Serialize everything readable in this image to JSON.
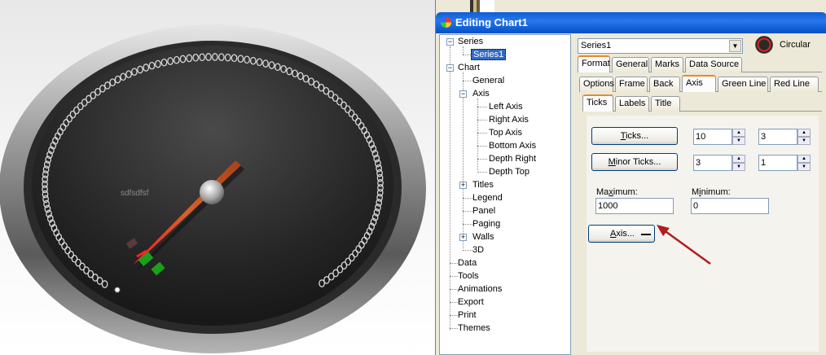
{
  "gauge": {
    "label": "sdfsdfsf",
    "colors": {
      "bezel": "#9a9a9a",
      "face": "#1e1e1e",
      "needle": "#c8501e",
      "accent": "#d81010",
      "green": "#1aa01a"
    }
  },
  "window": {
    "title": "Editing Chart1"
  },
  "tree": {
    "series": "Series",
    "series1": "Series1",
    "chart": "Chart",
    "general": "General",
    "axis": "Axis",
    "left_axis": "Left Axis",
    "right_axis": "Right Axis",
    "top_axis": "Top Axis",
    "bottom_axis": "Bottom Axis",
    "depth_right": "Depth Right",
    "depth_top": "Depth Top",
    "titles": "Titles",
    "legend": "Legend",
    "panel": "Panel",
    "paging": "Paging",
    "walls": "Walls",
    "three_d": "3D",
    "data": "Data",
    "tools": "Tools",
    "animations": "Animations",
    "export": "Export",
    "print": "Print",
    "themes": "Themes"
  },
  "series_picker": {
    "value": "Series1",
    "type_label": "Circular"
  },
  "tabs1": [
    "Format",
    "General",
    "Marks",
    "Data Source"
  ],
  "tabs2": [
    "Options",
    "Frame",
    "Back",
    "Axis",
    "Green Line",
    "Red Line"
  ],
  "tabs3": [
    "Ticks",
    "Labels",
    "Title"
  ],
  "ticks": {
    "ticks_btn_pre": "",
    "ticks_btn_u": "T",
    "ticks_btn_post": "icks...",
    "ticks_v1": "10",
    "ticks_v2": "3",
    "minor_btn_pre": "",
    "minor_btn_u": "M",
    "minor_btn_post": "inor Ticks...",
    "minor_v1": "3",
    "minor_v2": "1",
    "max_label_pre": "Ma",
    "max_label_u": "x",
    "max_label_post": "imum:",
    "max_value": "1000",
    "min_label_pre": "M",
    "min_label_u": "i",
    "min_label_post": "nimum:",
    "min_value": "0",
    "axis_btn_pre": "",
    "axis_btn_u": "A",
    "axis_btn_post": "xis..."
  }
}
